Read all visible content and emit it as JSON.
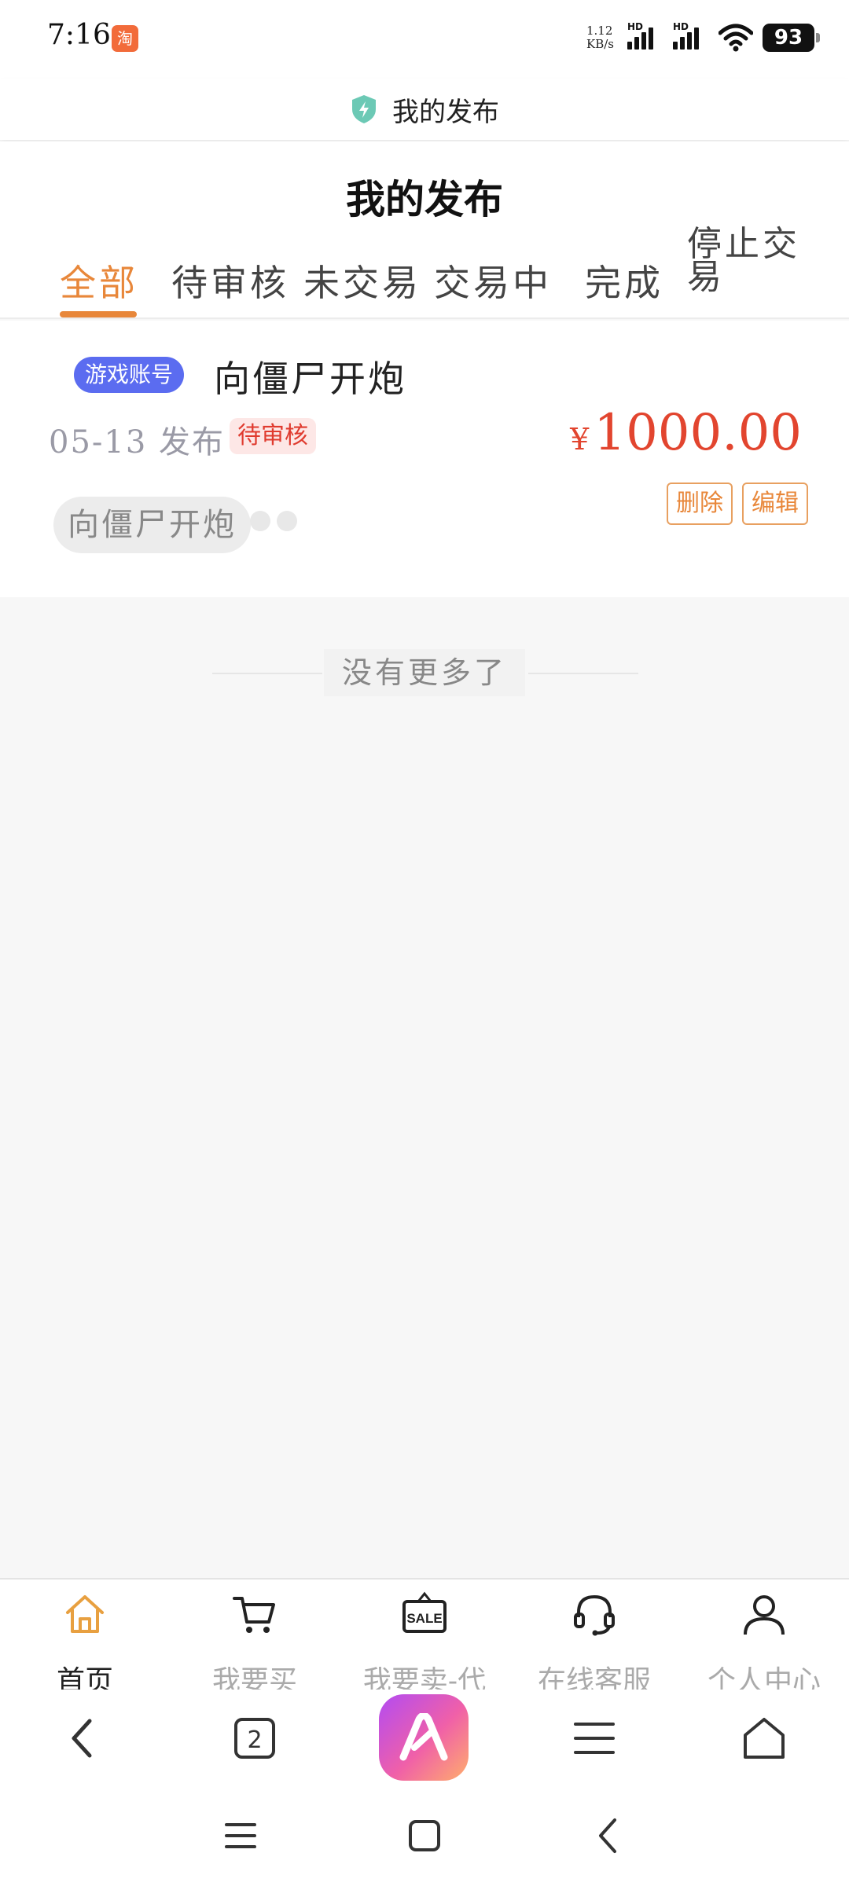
{
  "status_bar": {
    "time": "7:16",
    "app_badge": "淘",
    "net_speed_value": "1.12",
    "net_speed_unit": "KB/s",
    "signal_1_label": "HD",
    "signal_2_label": "HD",
    "battery": "93"
  },
  "browser": {
    "page_title": "我的发布"
  },
  "header": {
    "title": "我的发布",
    "tabs": [
      {
        "label": "全部",
        "active": true
      },
      {
        "label": "待审核",
        "active": false
      },
      {
        "label": "未交易",
        "active": false
      },
      {
        "label": "交易中",
        "active": false
      },
      {
        "label": "完成",
        "active": false
      },
      {
        "label": "停止交易",
        "active": false
      }
    ]
  },
  "listing": {
    "category_badge": "游戏账号",
    "title": "向僵尸开炮",
    "date": "05-13",
    "date_suffix": "发布",
    "status": "待审核",
    "currency": "¥",
    "price": "1000.00",
    "delete_label": "删除",
    "edit_label": "编辑",
    "game_chip": "向僵尸开炮"
  },
  "list_end": {
    "text": "没有更多了"
  },
  "bottom_nav": {
    "items": [
      {
        "label": "首页",
        "icon": "home-icon",
        "active": true
      },
      {
        "label": "我要买",
        "icon": "cart-icon",
        "active": false
      },
      {
        "label": "我要卖-代",
        "icon": "sale-sign-icon",
        "active": false
      },
      {
        "label": "在线客服",
        "icon": "headset-icon",
        "active": false
      },
      {
        "label": "个人中心",
        "icon": "user-icon",
        "active": false
      }
    ],
    "sale_sign_text": "SALE"
  },
  "browser_toolbar": {
    "tab_count": "2"
  },
  "colors": {
    "accent": "#e8873a",
    "price": "#e2452f",
    "badge_blue": "#5b6cf0",
    "status_red": "#e03b2f"
  }
}
